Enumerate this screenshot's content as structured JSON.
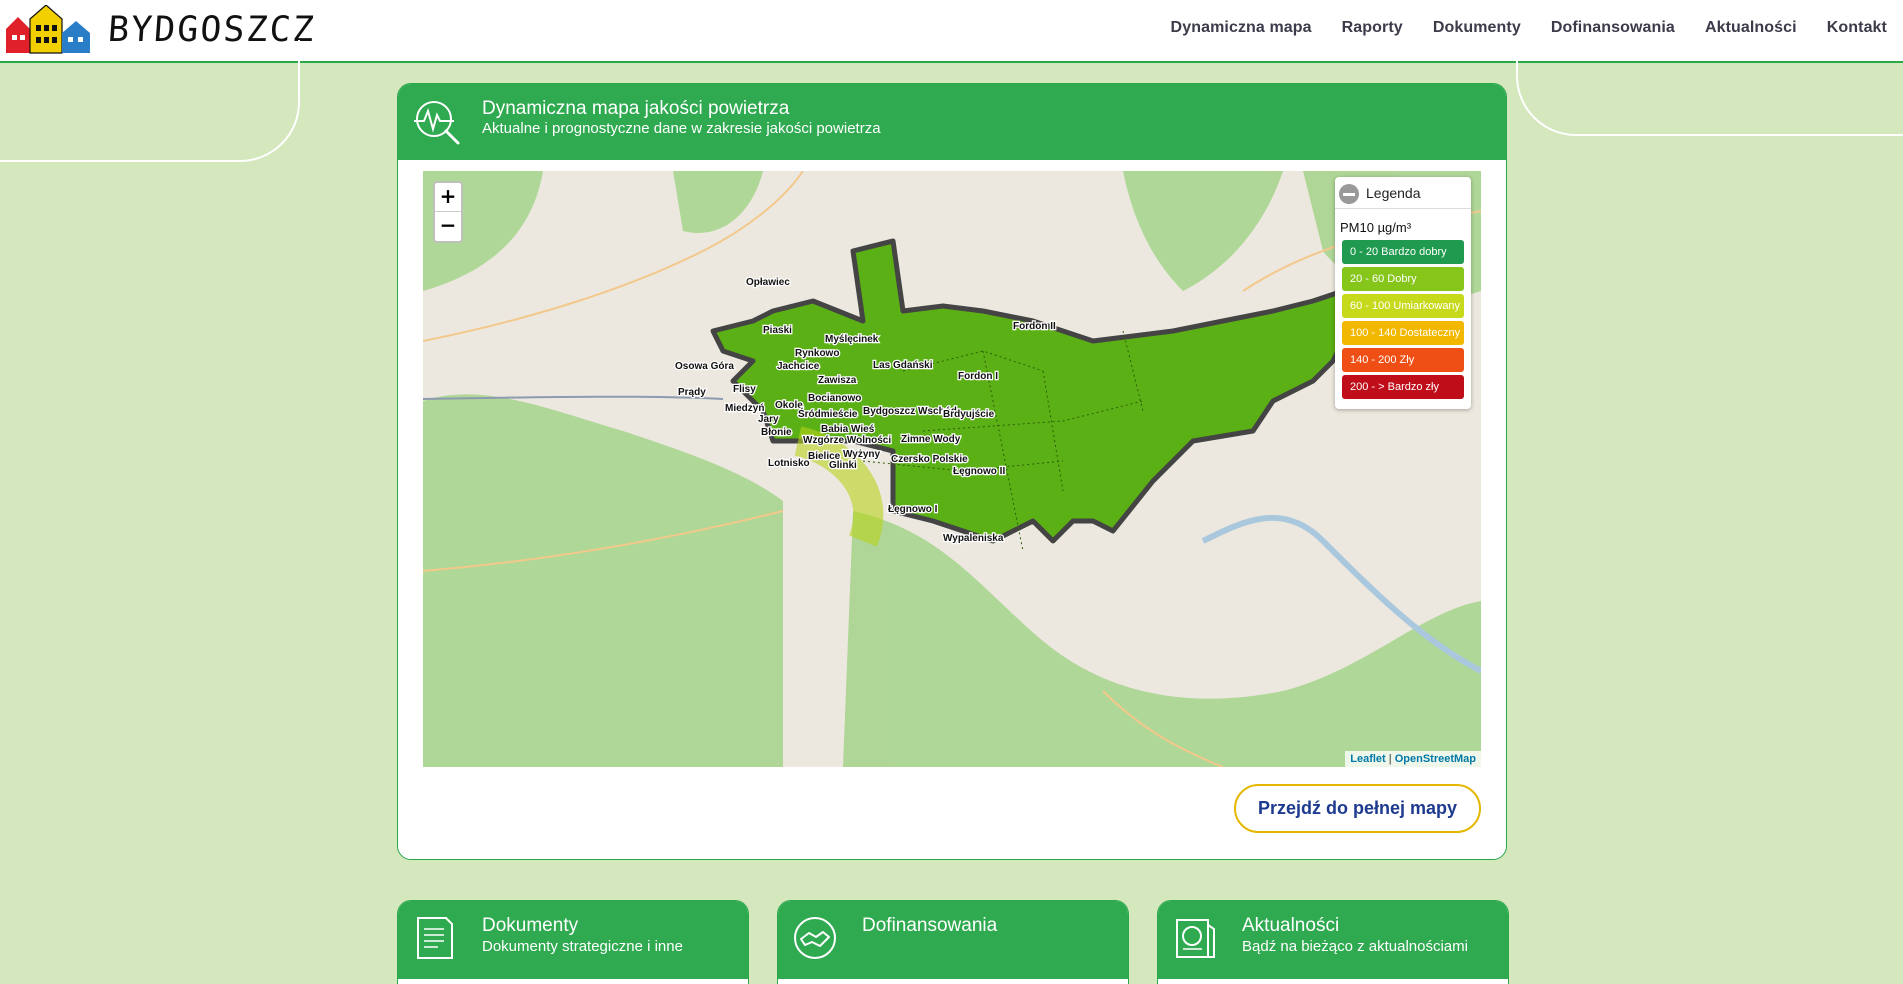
{
  "header": {
    "logo_text": "BYDGOSZCZ",
    "nav": [
      "Dynamiczna mapa",
      "Raporty",
      "Dokumenty",
      "Dofinansowania",
      "Aktualności",
      "Kontakt"
    ]
  },
  "panel": {
    "title": "Dynamiczna mapa jakości powietrza",
    "subtitle": "Aktualne i prognostyczne dane w zakresie jakości powietrza",
    "icon": "air-quality-search-icon"
  },
  "map": {
    "zoom_in": "+",
    "zoom_out": "−",
    "legend_title": "Legenda",
    "legend_param": "PM10 µg/m³",
    "legend_items": [
      {
        "label": "0 - 20 Bardzo dobry",
        "color": "#1f9a4e"
      },
      {
        "label": "20 - 60 Dobry",
        "color": "#86c51a"
      },
      {
        "label": "60 - 100 Umiarkowany",
        "color": "#c7d91b"
      },
      {
        "label": "100 - 140 Dostateczny",
        "color": "#f2b800"
      },
      {
        "label": "140 - 200 Zły",
        "color": "#ef4f14"
      },
      {
        "label": "200 - > Bardzo zły",
        "color": "#c00d1a"
      }
    ],
    "attribution_leaflet": "Leaflet",
    "attribution_sep": " | ",
    "attribution_osm": "OpenStreetMap",
    "districts": [
      "Opławiec",
      "Piaski",
      "Myślęcinek",
      "Rynkowo",
      "Jachcice",
      "Osowa Góra",
      "Las Gdański",
      "Fordon II",
      "Fordon I",
      "Zawisza",
      "Flisy",
      "Prądy",
      "Bocianowo",
      "Okole",
      "Miedzyń",
      "Śródmieście",
      "Bydgoszcz Wschód",
      "Brdyujście",
      "Jary",
      "Babia Wieś",
      "Błonie",
      "Wzgórze Wolności",
      "Zimne Wody",
      "Wyżyny",
      "Bielice",
      "Lotnisko",
      "Glinki",
      "Czersko Polskie",
      "Łęgnowo II",
      "Łęgnowo I",
      "Wypaleniska"
    ],
    "fill_color": "#5ab014"
  },
  "full_map_button": "Przejdź do pełnej mapy",
  "cards": [
    {
      "title": "Dokumenty",
      "subtitle": "Dokumenty strategiczne i inne",
      "icon": "document-icon"
    },
    {
      "title": "Dofinansowania",
      "subtitle": "",
      "icon": "handshake-icon"
    },
    {
      "title": "Aktualności",
      "subtitle": "Bądź na bieżąco z aktualnościami",
      "icon": "news-icon"
    }
  ]
}
